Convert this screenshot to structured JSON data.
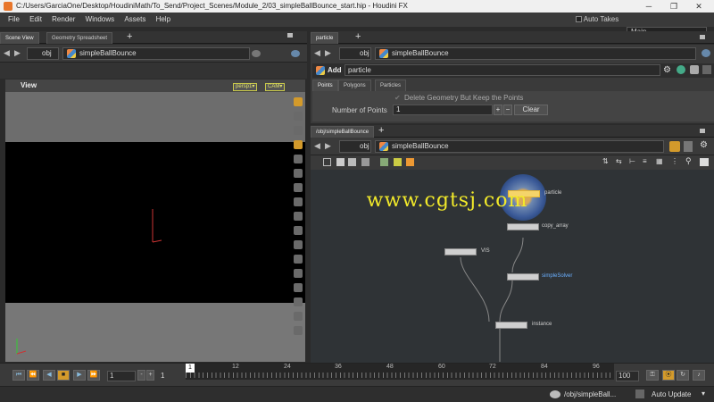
{
  "window": {
    "title": "C:/Users/GarciaOne/Desktop/HoudiniMath/To_Send/Project_Scenes/Module_2/03_simpleBallBounce_start.hip - Houdini FX",
    "min": "─",
    "max": "❐",
    "close": "✕"
  },
  "menu": [
    "File",
    "Edit",
    "Render",
    "Windows",
    "Assets",
    "Help"
  ],
  "auto_takes": "Auto Takes",
  "desktop": "Main",
  "left_tabs": [
    "Scene View",
    "Geometry Spreadsheet"
  ],
  "left_path": {
    "level": "obj",
    "node": "simpleBallBounce"
  },
  "viewport": {
    "title": "View",
    "camera": "persp1▾",
    "cam": "CAM▾"
  },
  "right_top_tab": "particle",
  "right_top_path": {
    "level": "obj",
    "node": "simpleBallBounce"
  },
  "param": {
    "type": "Add",
    "name": "particle",
    "tabs": [
      "Points",
      "Polygons",
      "Particles"
    ],
    "checkbox": "Delete Geometry But Keep the Points",
    "np_label": "Number of Points",
    "np_value": "1",
    "clear": "Clear"
  },
  "network_tab": "/obj/simpleBallBounce",
  "network_path": {
    "level": "obj",
    "node": "simpleBallBounce"
  },
  "nodes": [
    {
      "label": "particle"
    },
    {
      "label": "copy_array"
    },
    {
      "label": "VIS"
    },
    {
      "label": "simpleSolver"
    },
    {
      "label": "instance"
    }
  ],
  "watermark": "www.cgtsj.com",
  "timeline": {
    "start": "1",
    "current": "1",
    "end": "100",
    "ticks": [
      "12",
      "24",
      "36",
      "48",
      "60",
      "72",
      "84",
      "96"
    ],
    "marker": "1"
  },
  "status": {
    "path": "/obj/simpleBall...",
    "update": "Auto Update"
  }
}
